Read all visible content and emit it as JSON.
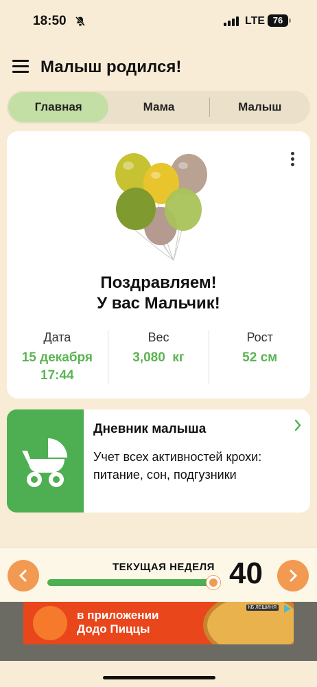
{
  "status_bar": {
    "time": "18:50",
    "network": "LTE",
    "battery": "76",
    "bell_icon": "bell-slash-icon"
  },
  "app_bar": {
    "title": "Малыш родился!",
    "menu_icon": "hamburger-menu-icon"
  },
  "tabs": [
    {
      "label": "Главная",
      "active": true
    },
    {
      "label": "Мама",
      "active": false
    },
    {
      "label": "Малыш",
      "active": false
    }
  ],
  "hero": {
    "line1": "Поздравляем!",
    "line2": "У вас Мальчик!",
    "stats": {
      "date": {
        "label": "Дата",
        "value_line1": "15 декабря",
        "value_line2": "17:44"
      },
      "weight": {
        "label": "Вес",
        "value": "3,080  кг"
      },
      "height": {
        "label": "Рост",
        "value": "52 см"
      }
    },
    "more_icon": "vertical-dots-icon",
    "image_icon": "balloons-icon"
  },
  "diary": {
    "title": "Дневник малыша",
    "description": "Учет всех активностей крохи: питание, сон, подгузники",
    "icon": "baby-stroller-icon",
    "chevron_icon": "chevron-right-icon"
  },
  "week_bar": {
    "label": "ТЕКУЩАЯ НЕДЕЛЯ",
    "week": "40",
    "progress": 1.0,
    "prev_icon": "chevron-left-icon",
    "next_icon": "chevron-right-icon"
  },
  "ad": {
    "line1": "в приложении",
    "line2": "Додо Пиццы",
    "badge": "КБ ЛЕШИНЯ"
  },
  "colors": {
    "background": "#f8ecd6",
    "accent_green": "#5cb453",
    "tab_active": "#c4dfa6",
    "accent_orange": "#f29a52"
  }
}
